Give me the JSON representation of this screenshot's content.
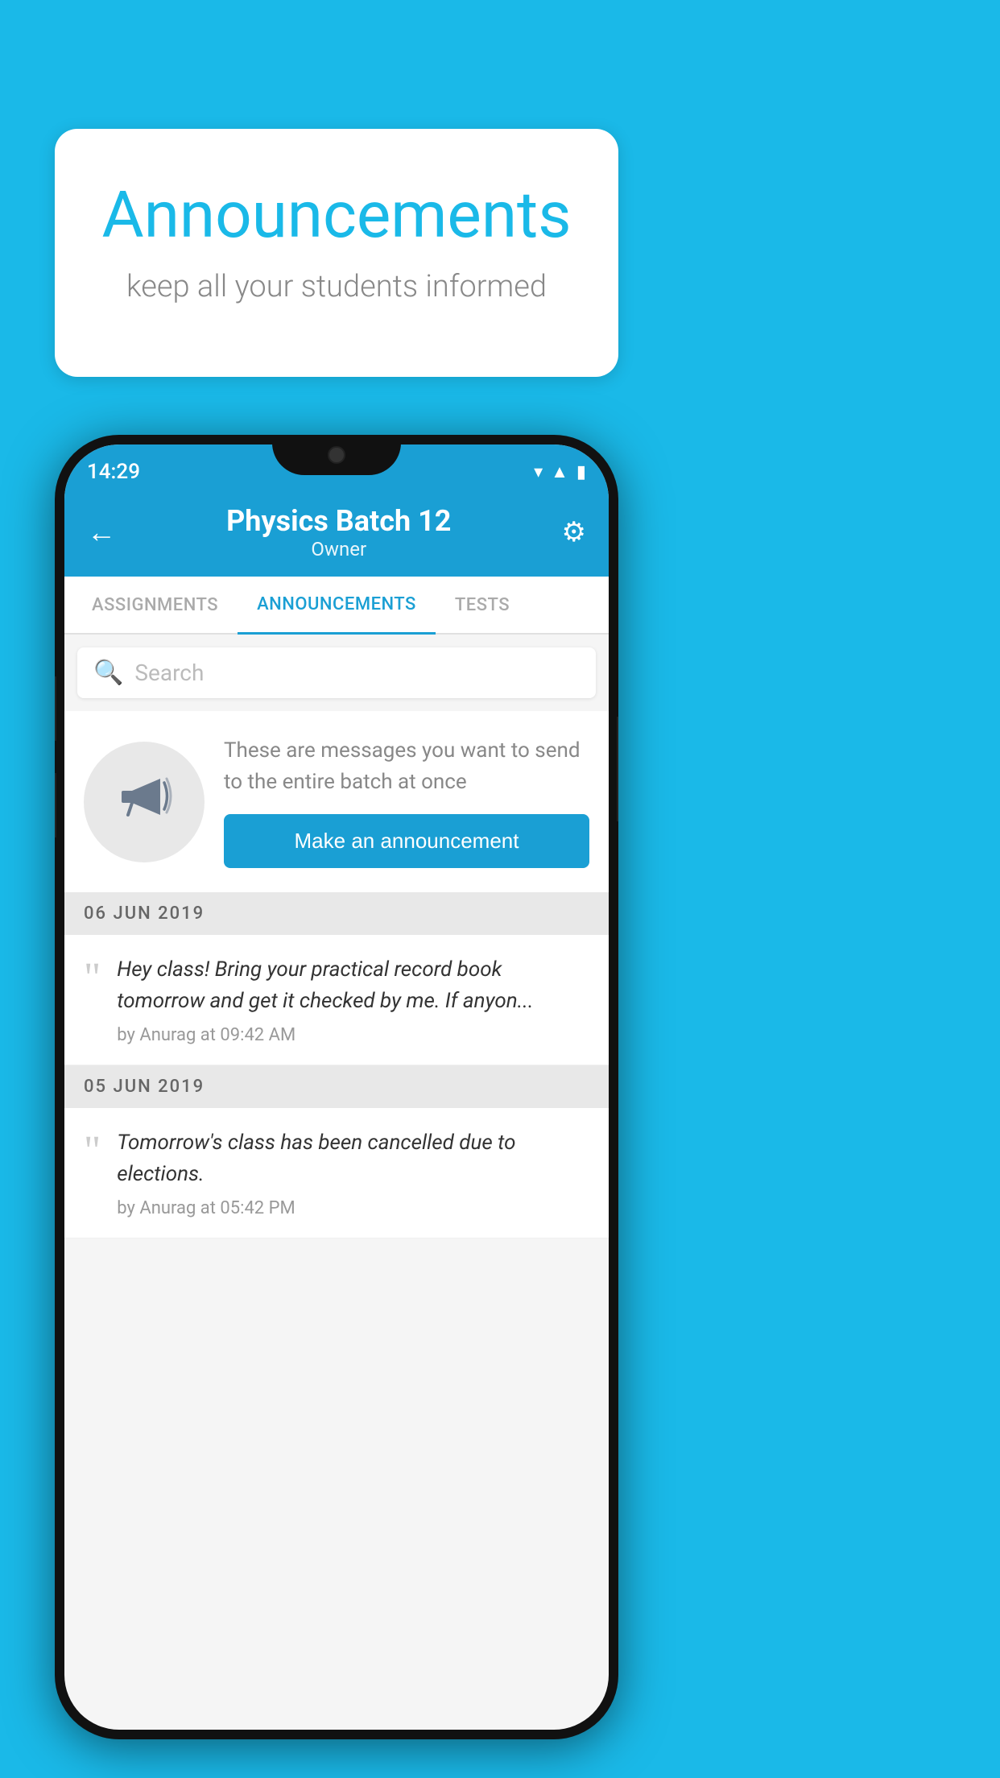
{
  "background_color": "#1ab9e8",
  "speech_bubble": {
    "title": "Announcements",
    "subtitle": "keep all your students informed"
  },
  "phone": {
    "status_bar": {
      "time": "14:29",
      "icons": [
        "wifi",
        "signal",
        "battery"
      ]
    },
    "header": {
      "title": "Physics Batch 12",
      "subtitle": "Owner",
      "back_label": "←",
      "gear_label": "⚙"
    },
    "tabs": [
      {
        "label": "ASSIGNMENTS",
        "active": false
      },
      {
        "label": "ANNOUNCEMENTS",
        "active": true
      },
      {
        "label": "TESTS",
        "active": false
      }
    ],
    "search": {
      "placeholder": "Search"
    },
    "promo": {
      "description": "These are messages you want to send to the entire batch at once",
      "button_label": "Make an announcement"
    },
    "announcements": [
      {
        "date": "06  JUN  2019",
        "message": "Hey class! Bring your practical record book tomorrow and get it checked by me. If anyon...",
        "author": "by Anurag at 09:42 AM"
      },
      {
        "date": "05  JUN  2019",
        "message": "Tomorrow's class has been cancelled due to elections.",
        "author": "by Anurag at 05:42 PM"
      }
    ]
  }
}
